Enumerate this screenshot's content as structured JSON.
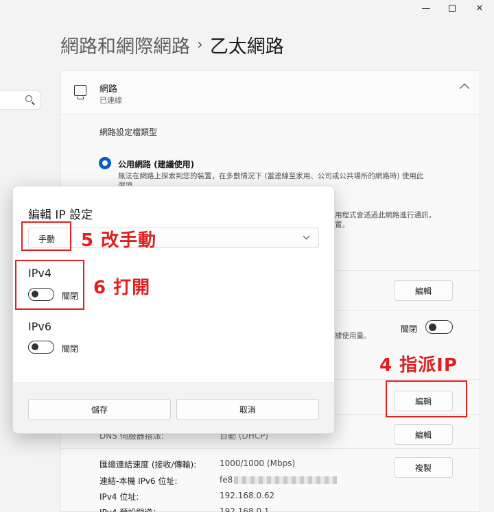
{
  "window": {
    "min_glyph": "—",
    "close_glyph": "✕"
  },
  "breadcrumb": {
    "parent": "網路和網際網路",
    "separator": "›",
    "current": "乙太網路"
  },
  "network": {
    "title": "網路",
    "status": "已連線",
    "profile_label": "網路設定檔類型",
    "option_label": "公用網路 (建議使用)",
    "option_desc_1": "無法在網路上探索到您的裝置，在多數情況下 (當連線至家用、公司或公共場所的網路時) 使用此",
    "option_desc_2": "選項。",
    "desc_fragment_1": "用程式會透過此網路進行通訊，",
    "desc_fragment_2": "置。",
    "metered_fragment": "據使用量。",
    "edit_label": "編輯",
    "copy_label": "複製",
    "toggle_off_label": "關閉"
  },
  "properties": {
    "dns_label": "DNS 伺服器指派:",
    "dns_value": "自動 (DHCP)",
    "rows": [
      {
        "label": "匯總連結速度 (接收/傳輸):",
        "value": "1000/1000 (Mbps)"
      },
      {
        "label": "連結-本機 IPv6 位址:",
        "value": "fe8"
      },
      {
        "label": "IPv4 位址:",
        "value": "192.168.0.62"
      },
      {
        "label": "IPv4 預設閘道：",
        "value": "192.168.0.1"
      }
    ]
  },
  "dialog": {
    "title": "編輯 IP 設定",
    "mode_value": "手動",
    "ipv4_label": "IPv4",
    "ipv4_toggle_label": "關閉",
    "ipv6_label": "IPv6",
    "ipv6_toggle_label": "關閉",
    "save_label": "儲存",
    "cancel_label": "取消"
  },
  "annotations": {
    "step4": "4 指派IP",
    "step5": "5 改手動",
    "step6": "6 打開",
    "color": "#e02020"
  },
  "colors": {
    "accent": "#0a5bc4",
    "background": "#f3f3f3"
  }
}
